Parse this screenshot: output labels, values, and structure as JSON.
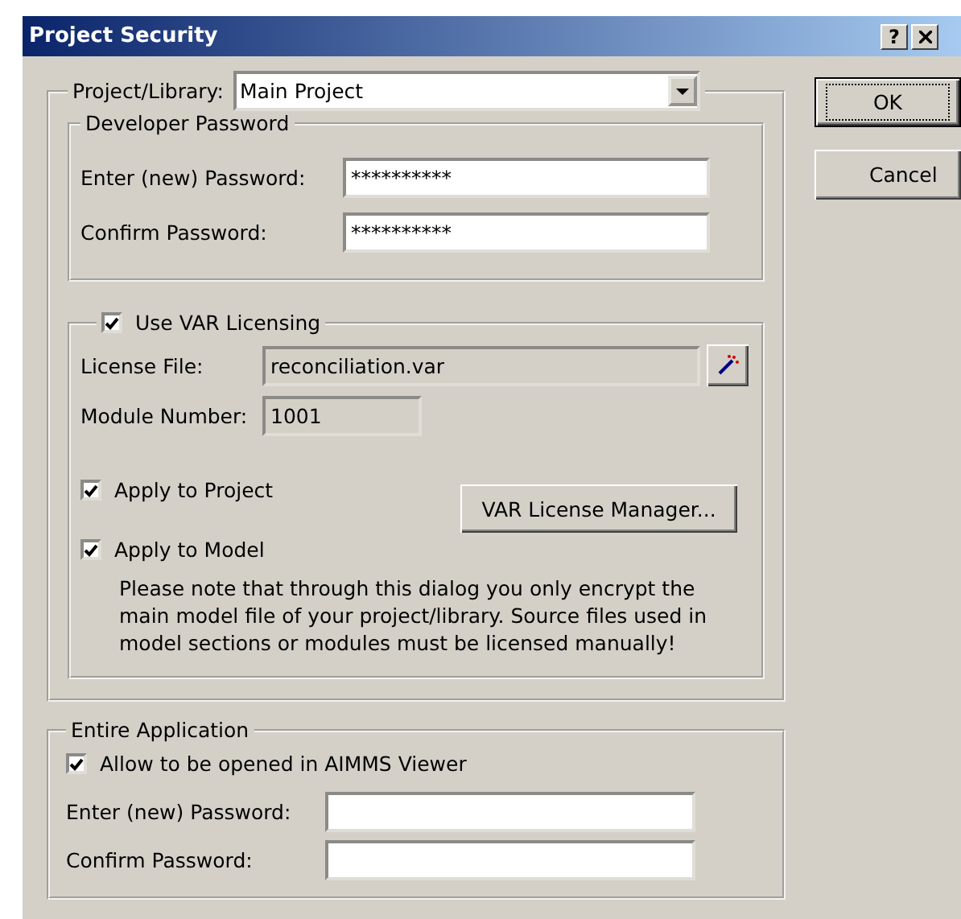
{
  "window": {
    "title": "Project Security",
    "help_button": "?"
  },
  "project_library": {
    "label": "Project/Library:",
    "value": "Main Project"
  },
  "developer_password": {
    "title": "Developer Password",
    "fields": [
      {
        "label": "Enter (new) Password:",
        "value": "**********"
      },
      {
        "label": "Confirm Password:",
        "value": "**********"
      }
    ]
  },
  "var_licensing": {
    "label": "Use VAR Licensing",
    "checked": true,
    "license_file": {
      "label": "License File:",
      "value": "reconciliation.var"
    },
    "module_number": {
      "label": "Module Number:",
      "value": "1001"
    },
    "options": [
      {
        "label": "Apply to Project",
        "checked": true
      },
      {
        "label": "Apply to Model",
        "checked": true
      }
    ],
    "manager_button": "VAR License Manager...",
    "note": "Please note that through this dialog you only encrypt the main model file of your project/library.  Source files used in model sections or modules must be licensed manually!"
  },
  "entire_application": {
    "title": "Entire Application",
    "allow": {
      "label": "Allow to be opened in AIMMS Viewer",
      "checked": true
    },
    "fields": [
      {
        "label": "Enter (new) Password:"
      },
      {
        "label": "Confirm Password:"
      }
    ]
  },
  "buttons": [
    {
      "label": "OK",
      "default": true
    },
    {
      "label": "Cancel",
      "default": false
    }
  ]
}
